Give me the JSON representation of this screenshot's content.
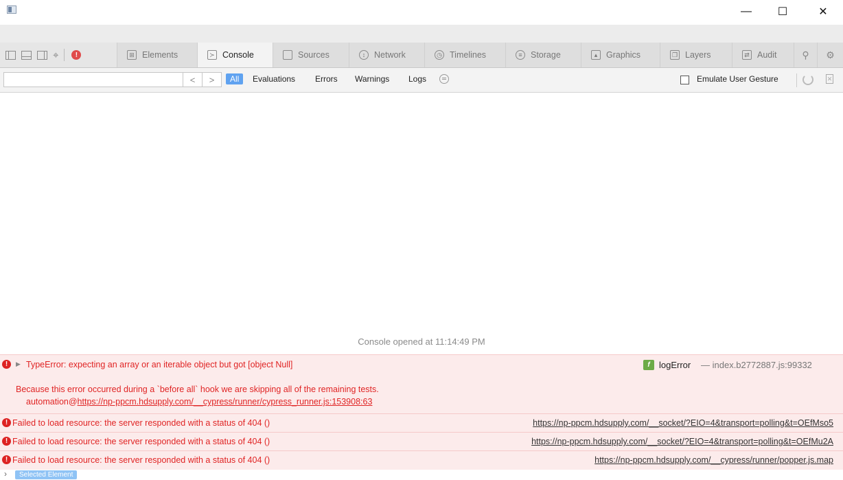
{
  "window": {
    "minimize_glyph": "—",
    "maximize_glyph": "☐",
    "close_glyph": "✕"
  },
  "tabs": [
    {
      "label": "Elements",
      "icon": "elements-icon"
    },
    {
      "label": "Console",
      "icon": "console-icon",
      "active": true
    },
    {
      "label": "Sources",
      "icon": "sources-icon"
    },
    {
      "label": "Network",
      "icon": "network-icon"
    },
    {
      "label": "Timelines",
      "icon": "timelines-icon"
    },
    {
      "label": "Storage",
      "icon": "storage-icon"
    },
    {
      "label": "Graphics",
      "icon": "graphics-icon"
    },
    {
      "label": "Layers",
      "icon": "layers-icon"
    },
    {
      "label": "Audit",
      "icon": "audit-icon"
    }
  ],
  "filters": {
    "search_value": "",
    "all": "All",
    "evaluations": "Evaluations",
    "errors": "Errors",
    "warnings": "Warnings",
    "logs": "Logs",
    "emulate_label": "Emulate User Gesture",
    "emulate_checked": false
  },
  "console": {
    "opened_text": "Console opened at 11:14:49 PM",
    "type_error": {
      "message": "TypeError: expecting an array or an iterable object but got [object Null]",
      "detail": "Because this error occurred during a `before all` hook we are skipping all of the remaining tests.",
      "stack_prefix": "automation@",
      "stack_link": "https://np-ppcm.hdsupply.com/__cypress/runner/cypress_runner.js:153908:63",
      "fn_badge": "f",
      "fn_name": "logError",
      "fn_location": "— index.b2772887.js:99332"
    },
    "errors": [
      {
        "message": "Failed to load resource: the server responded with a status of 404 ()",
        "link": "https://np-ppcm.hdsupply.com/__socket/?EIO=4&transport=polling&t=OEfMso5"
      },
      {
        "message": "Failed to load resource: the server responded with a status of 404 ()",
        "link": "https://np-ppcm.hdsupply.com/__socket/?EIO=4&transport=polling&t=OEfMu2A"
      },
      {
        "message": "Failed to load resource: the server responded with a status of 404 ()",
        "link": "https://np-ppcm.hdsupply.com/__cypress/runner/popper.js.map"
      }
    ],
    "selected_element": "Selected Element"
  },
  "colors": {
    "error_text": "#e02424",
    "error_bg": "#fcebeb",
    "accent": "#5fa2f0"
  }
}
